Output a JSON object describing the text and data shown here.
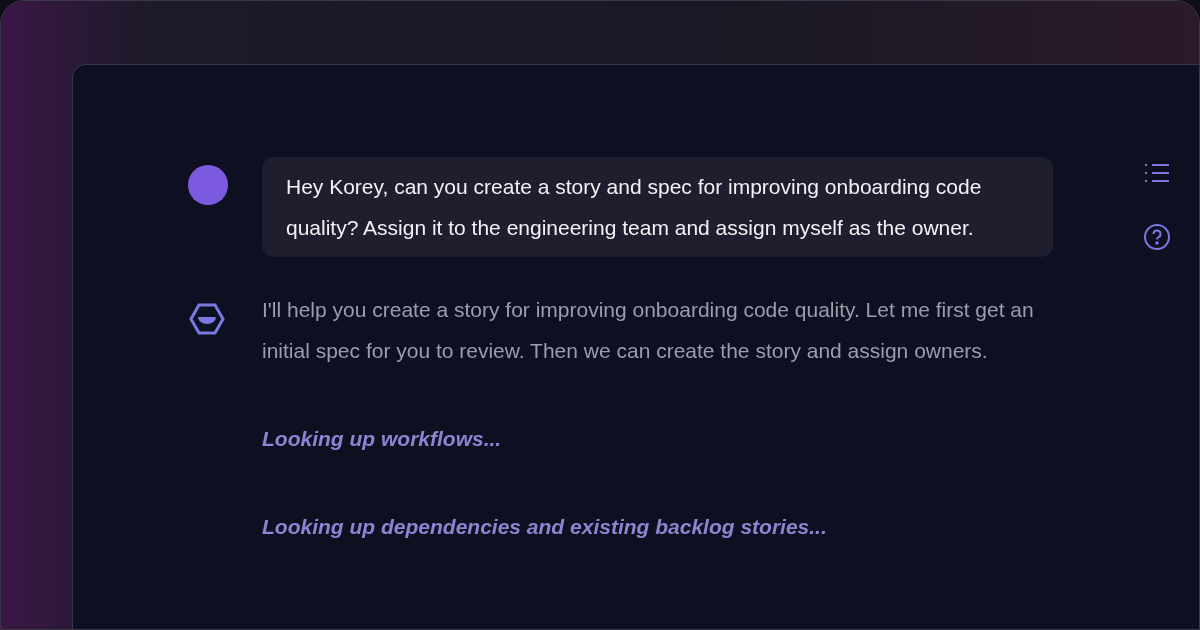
{
  "messages": [
    {
      "kind": "user",
      "text": "Hey Korey, can you create a story and spec for improving onboarding code quality? Assign it to the engineering team and assign myself as the owner."
    },
    {
      "kind": "assistant",
      "text": "I'll help you create a story for improving onboarding code quality. Let me first get an initial spec for you to review. Then we can create the story and assign owners.",
      "status": [
        "Looking up workflows...",
        "Looking up dependencies and existing backlog stories..."
      ]
    }
  ]
}
